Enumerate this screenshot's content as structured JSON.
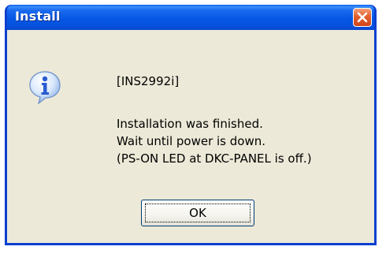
{
  "window": {
    "title": "Install",
    "close_icon": "close-icon",
    "accent_color": "#0a3fcf"
  },
  "dialog": {
    "icon": "info-icon",
    "code": "[INS2992i]",
    "message_lines": [
      "Installation was finished.",
      "Wait until power is down.",
      "(PS-ON LED at DKC-PANEL is off.)"
    ],
    "ok_label": "OK"
  }
}
